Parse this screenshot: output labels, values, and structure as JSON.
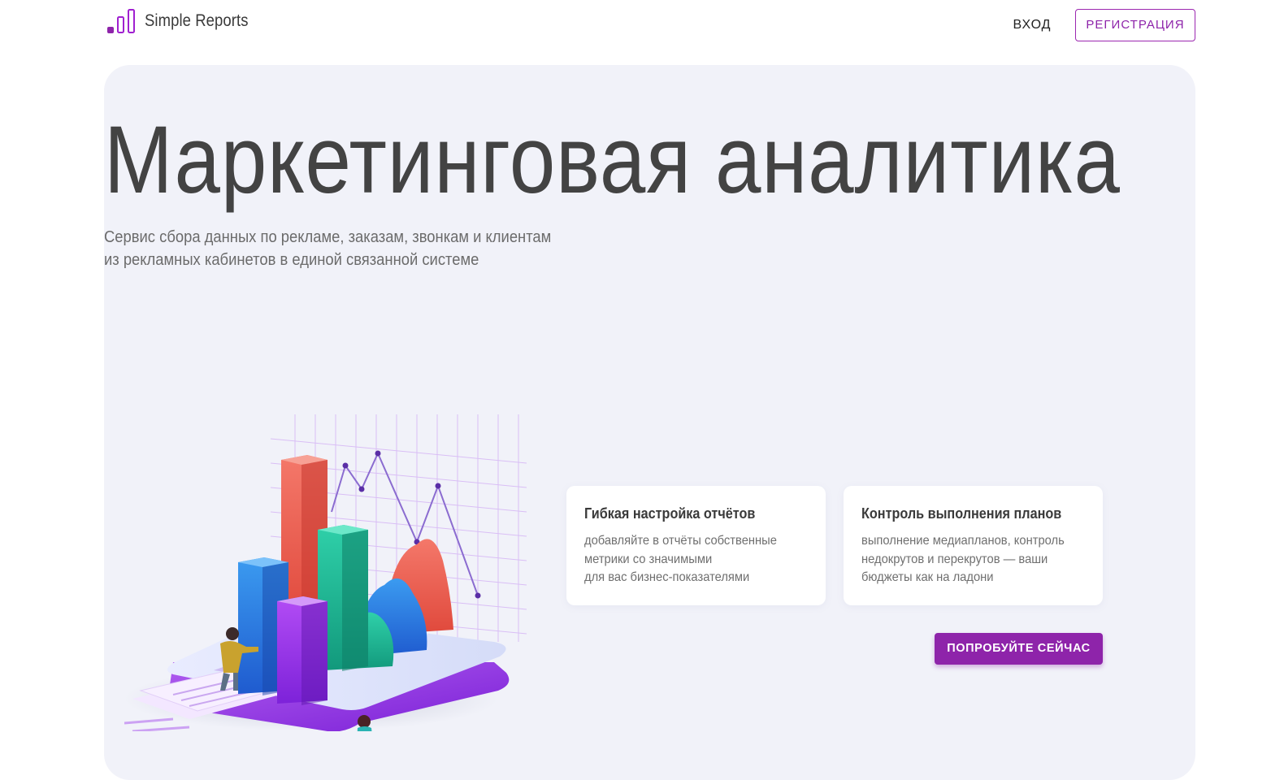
{
  "header": {
    "brand": "Simple Reports",
    "login_label": "ВХОД",
    "register_label": "РЕГИСТРАЦИЯ"
  },
  "hero": {
    "title": "Маркетинговая аналитика",
    "subtitle_lines": [
      "Сервис сбора данных по рекламе, заказам, звонкам и клиентам",
      "из рекламных кабинетов в единой связанной системе"
    ]
  },
  "features": [
    {
      "title": "Гибкая настройка отчётов",
      "text_lines": [
        "добавляйте в отчёты собственные",
        "метрики со значимыми",
        "для вас бизнес-показателями"
      ]
    },
    {
      "title": "Контроль выполнения планов",
      "text_lines": [
        "выполнение медиапланов, контроль",
        "недокрутов и перекрутов — ваши",
        "бюджеты как на ладони"
      ]
    }
  ],
  "cta": {
    "label": "ПОПРОБУЙТЕ СЕЙЧАС"
  },
  "icons": {
    "logo": "bar-chart-logo-icon",
    "illustration": "analytics-chart-illustration"
  },
  "colors": {
    "accent": "#8e24aa",
    "hero_background": "#f1f2f9",
    "title_text": "#434343"
  }
}
